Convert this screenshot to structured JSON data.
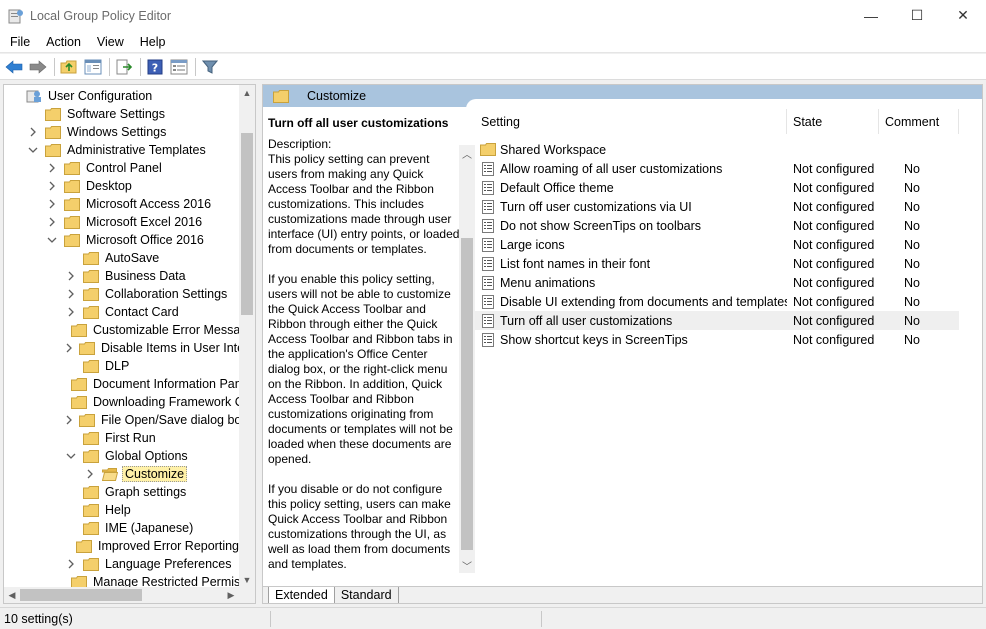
{
  "window": {
    "title": "Local Group Policy Editor",
    "controls": {
      "minimize": "—",
      "maximize": "☐",
      "close": "✕"
    }
  },
  "menu": [
    "File",
    "Action",
    "View",
    "Help"
  ],
  "toolbar": {
    "buttons": [
      "back-icon",
      "forward-icon",
      "up-folder-icon",
      "show-hide-tree-icon",
      "export-list-icon",
      "help-icon",
      "properties-icon",
      "filter-icon"
    ]
  },
  "tree": {
    "items": [
      {
        "label": "User Configuration",
        "level": 0,
        "expander": "",
        "icon": "user-config-icon"
      },
      {
        "label": "Software Settings",
        "level": 1,
        "expander": "",
        "icon": "folder-icon"
      },
      {
        "label": "Windows Settings",
        "level": 1,
        "expander": ">",
        "icon": "folder-icon"
      },
      {
        "label": "Administrative Templates",
        "level": 1,
        "expander": "v",
        "icon": "folder-icon"
      },
      {
        "label": "Control Panel",
        "level": 2,
        "expander": ">",
        "icon": "folder-icon"
      },
      {
        "label": "Desktop",
        "level": 2,
        "expander": ">",
        "icon": "folder-icon"
      },
      {
        "label": "Microsoft Access 2016",
        "level": 2,
        "expander": ">",
        "icon": "folder-icon"
      },
      {
        "label": "Microsoft Excel 2016",
        "level": 2,
        "expander": ">",
        "icon": "folder-icon"
      },
      {
        "label": "Microsoft Office 2016",
        "level": 2,
        "expander": "v",
        "icon": "folder-icon"
      },
      {
        "label": "AutoSave",
        "level": 3,
        "expander": "",
        "icon": "folder-icon"
      },
      {
        "label": "Business Data",
        "level": 3,
        "expander": ">",
        "icon": "folder-icon"
      },
      {
        "label": "Collaboration Settings",
        "level": 3,
        "expander": ">",
        "icon": "folder-icon"
      },
      {
        "label": "Contact Card",
        "level": 3,
        "expander": ">",
        "icon": "folder-icon"
      },
      {
        "label": "Customizable Error Messages",
        "level": 3,
        "expander": "",
        "icon": "folder-icon"
      },
      {
        "label": "Disable Items in User Interfac",
        "level": 3,
        "expander": ">",
        "icon": "folder-icon"
      },
      {
        "label": "DLP",
        "level": 3,
        "expander": "",
        "icon": "folder-icon"
      },
      {
        "label": "Document Information Panel",
        "level": 3,
        "expander": "",
        "icon": "folder-icon"
      },
      {
        "label": "Downloading Framework Cor",
        "level": 3,
        "expander": "",
        "icon": "folder-icon"
      },
      {
        "label": "File Open/Save dialog box",
        "level": 3,
        "expander": ">",
        "icon": "folder-icon"
      },
      {
        "label": "First Run",
        "level": 3,
        "expander": "",
        "icon": "folder-icon"
      },
      {
        "label": "Global Options",
        "level": 3,
        "expander": "v",
        "icon": "folder-icon"
      },
      {
        "label": "Customize",
        "level": 4,
        "expander": ">",
        "icon": "folder-open-icon",
        "selected": true
      },
      {
        "label": "Graph settings",
        "level": 3,
        "expander": "",
        "icon": "folder-icon"
      },
      {
        "label": "Help",
        "level": 3,
        "expander": "",
        "icon": "folder-icon"
      },
      {
        "label": "IME (Japanese)",
        "level": 3,
        "expander": "",
        "icon": "folder-icon"
      },
      {
        "label": "Improved Error Reporting",
        "level": 3,
        "expander": "",
        "icon": "folder-icon"
      },
      {
        "label": "Language Preferences",
        "level": 3,
        "expander": ">",
        "icon": "folder-icon"
      },
      {
        "label": "Manage Restricted Permissio",
        "level": 3,
        "expander": "",
        "icon": "folder-icon"
      }
    ]
  },
  "details": {
    "header_title": "Customize",
    "policy_title": "Turn off all user customizations",
    "description_label": "Description:",
    "paragraphs": [
      "This policy setting can prevent users from making any Quick Access Toolbar and the Ribbon customizations.  This includes customizations made through user interface (UI) entry points, or loaded from documents or templates.",
      "If you enable this policy setting, users will not be able to customize the Quick Access Toolbar and Ribbon through either the Quick Access Toolbar and Ribbon tabs in the application's Office Center dialog box, or the right-click menu on the Ribbon.  In addition, Quick Access Toolbar and Ribbon customizations originating from documents or templates will not be loaded when these documents are opened.",
      "If you disable or do not configure this policy setting, users can make Quick Access Toolbar and Ribbon customizations through the UI, as well as load them from documents and templates."
    ]
  },
  "list": {
    "columns": [
      "Setting",
      "State",
      "Comment"
    ],
    "rows": [
      {
        "setting": "Shared Workspace",
        "state": "",
        "comment": "",
        "icon": "folder-icon"
      },
      {
        "setting": "Allow roaming of all user customizations",
        "state": "Not configured",
        "comment": "No",
        "icon": "policy-icon"
      },
      {
        "setting": "Default Office theme",
        "state": "Not configured",
        "comment": "No",
        "icon": "policy-icon"
      },
      {
        "setting": "Turn off user customizations via UI",
        "state": "Not configured",
        "comment": "No",
        "icon": "policy-icon"
      },
      {
        "setting": "Do not show ScreenTips on toolbars",
        "state": "Not configured",
        "comment": "No",
        "icon": "policy-icon"
      },
      {
        "setting": "Large icons",
        "state": "Not configured",
        "comment": "No",
        "icon": "policy-icon"
      },
      {
        "setting": "List font names in their font",
        "state": "Not configured",
        "comment": "No",
        "icon": "policy-icon"
      },
      {
        "setting": "Menu animations",
        "state": "Not configured",
        "comment": "No",
        "icon": "policy-icon"
      },
      {
        "setting": "Disable UI extending from documents and templates",
        "state": "Not configured",
        "comment": "No",
        "icon": "policy-icon"
      },
      {
        "setting": "Turn off all user customizations",
        "state": "Not configured",
        "comment": "No",
        "icon": "policy-icon",
        "selected": true
      },
      {
        "setting": "Show shortcut keys in ScreenTips",
        "state": "Not configured",
        "comment": "No",
        "icon": "policy-icon"
      }
    ]
  },
  "tabs": [
    "Extended",
    "Standard"
  ],
  "status": {
    "text": "10 setting(s)"
  },
  "colors": {
    "header_blue": "#a9c4de",
    "folder_yellow": "#f4cf6b",
    "selection_yellow": "#fff1a8"
  }
}
